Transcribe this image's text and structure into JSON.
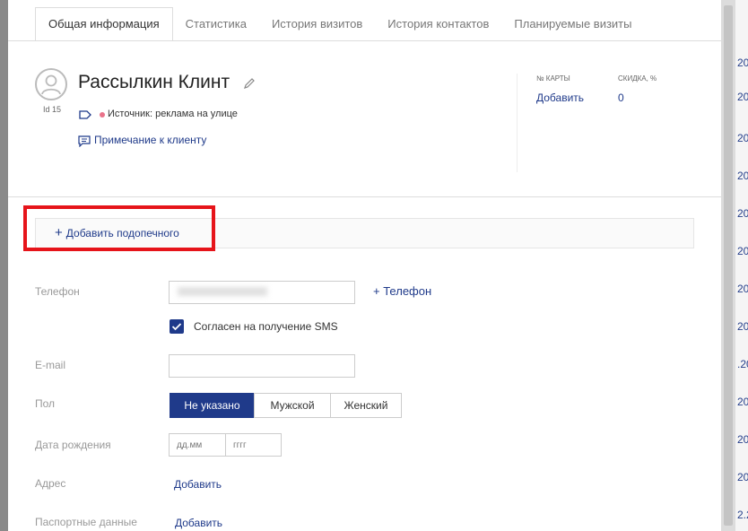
{
  "tabs": [
    "Общая информация",
    "Статистика",
    "История визитов",
    "История контактов",
    "Планируемые визиты"
  ],
  "client": {
    "name": "Рассылкин Клинт",
    "id_label": "Id 15",
    "source": "Источник: реклама на улице",
    "note_link": "Примечание к клиенту"
  },
  "card": {
    "label": "№ КАРТЫ",
    "value": "Добавить"
  },
  "discount": {
    "label": "СКИДКА, %",
    "value": "0"
  },
  "ward": {
    "add_label": "Добавить подопечного"
  },
  "form": {
    "phone_label": "Телефон",
    "add_phone": "Телефон",
    "sms_consent": "Согласен на получение SMS",
    "email_label": "E-mail",
    "gender_label": "Пол",
    "gender_options": [
      "Не указано",
      "Мужской",
      "Женский"
    ],
    "birth_label": "Дата рождения",
    "birth_day_placeholder": "дд.мм",
    "birth_year_placeholder": "гггг",
    "address_label": "Адрес",
    "address_link": "Добавить",
    "passport_label": "Паспортные данные",
    "passport_link": "Добавить"
  },
  "colors": {
    "accent": "#1f3a8a",
    "highlight": "#e6141a",
    "source_dot": "#e9738a"
  }
}
